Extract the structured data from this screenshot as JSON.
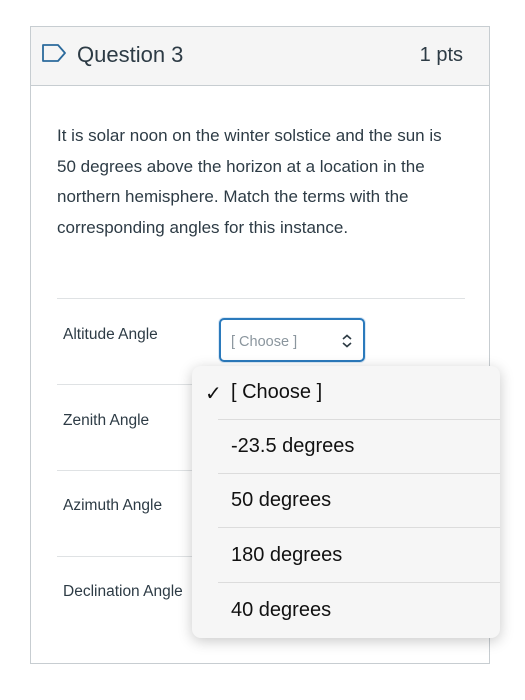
{
  "question": {
    "title": "Question 3",
    "points": "1 pts",
    "text": "It is solar noon on the winter solstice and the sun is 50 degrees above the horizon at a location in the northern hemisphere.  Match the terms with the corresponding angles for this instance."
  },
  "terms": [
    "Altitude Angle",
    "Zenith Angle",
    "Azimuth Angle",
    "Declination Angle"
  ],
  "select": {
    "value": "[ Choose ]"
  },
  "dropdown": {
    "options": [
      "[ Choose ]",
      "-23.5 degrees",
      "50 degrees",
      "180 degrees",
      "40 degrees"
    ],
    "selected_index": 0,
    "check": "✓"
  },
  "icons": {
    "flag": "flag-icon",
    "select_arrows": "updown-chevron-icon"
  },
  "colors": {
    "accent": "#2b7abc",
    "text": "#2d3b45",
    "border": "#c7cdd1"
  }
}
